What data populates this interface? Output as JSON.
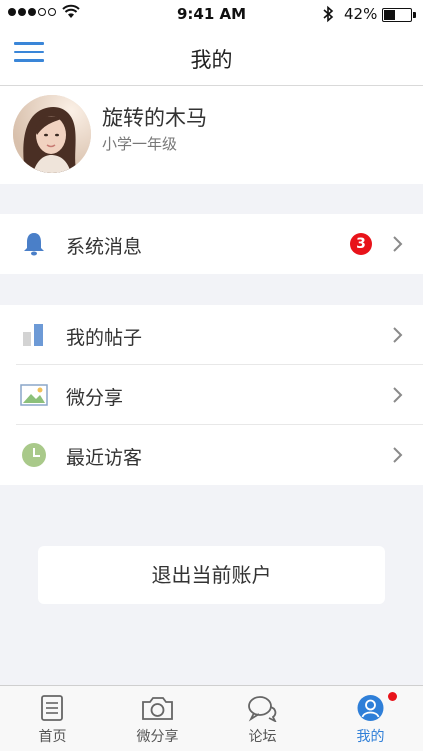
{
  "status_bar": {
    "time": "9:41 AM",
    "battery_percent": "42%",
    "battery_level": 0.42,
    "signal_bars": 3
  },
  "nav": {
    "title": "我的"
  },
  "profile": {
    "name": "旋转的木马",
    "grade": "小学一年级"
  },
  "section1": {
    "items": [
      {
        "label": "系统消息",
        "icon": "bell-icon",
        "badge": "3"
      }
    ]
  },
  "section2": {
    "items": [
      {
        "label": "我的帖子",
        "icon": "bar-chart-icon"
      },
      {
        "label": "微分享",
        "icon": "image-icon"
      },
      {
        "label": "最近访客",
        "icon": "clock-icon"
      }
    ]
  },
  "logout": {
    "label": "退出当前账户"
  },
  "tabbar": {
    "tabs": [
      {
        "label": "首页",
        "icon": "document-icon",
        "active": false
      },
      {
        "label": "微分享",
        "icon": "camera-icon",
        "active": false
      },
      {
        "label": "论坛",
        "icon": "chat-bubbles-icon",
        "active": false
      },
      {
        "label": "我的",
        "icon": "user-icon",
        "active": true,
        "dot": true
      }
    ]
  },
  "colors": {
    "accent": "#2f7fd8",
    "badge": "#e8131a",
    "background": "#f2f3f7"
  }
}
